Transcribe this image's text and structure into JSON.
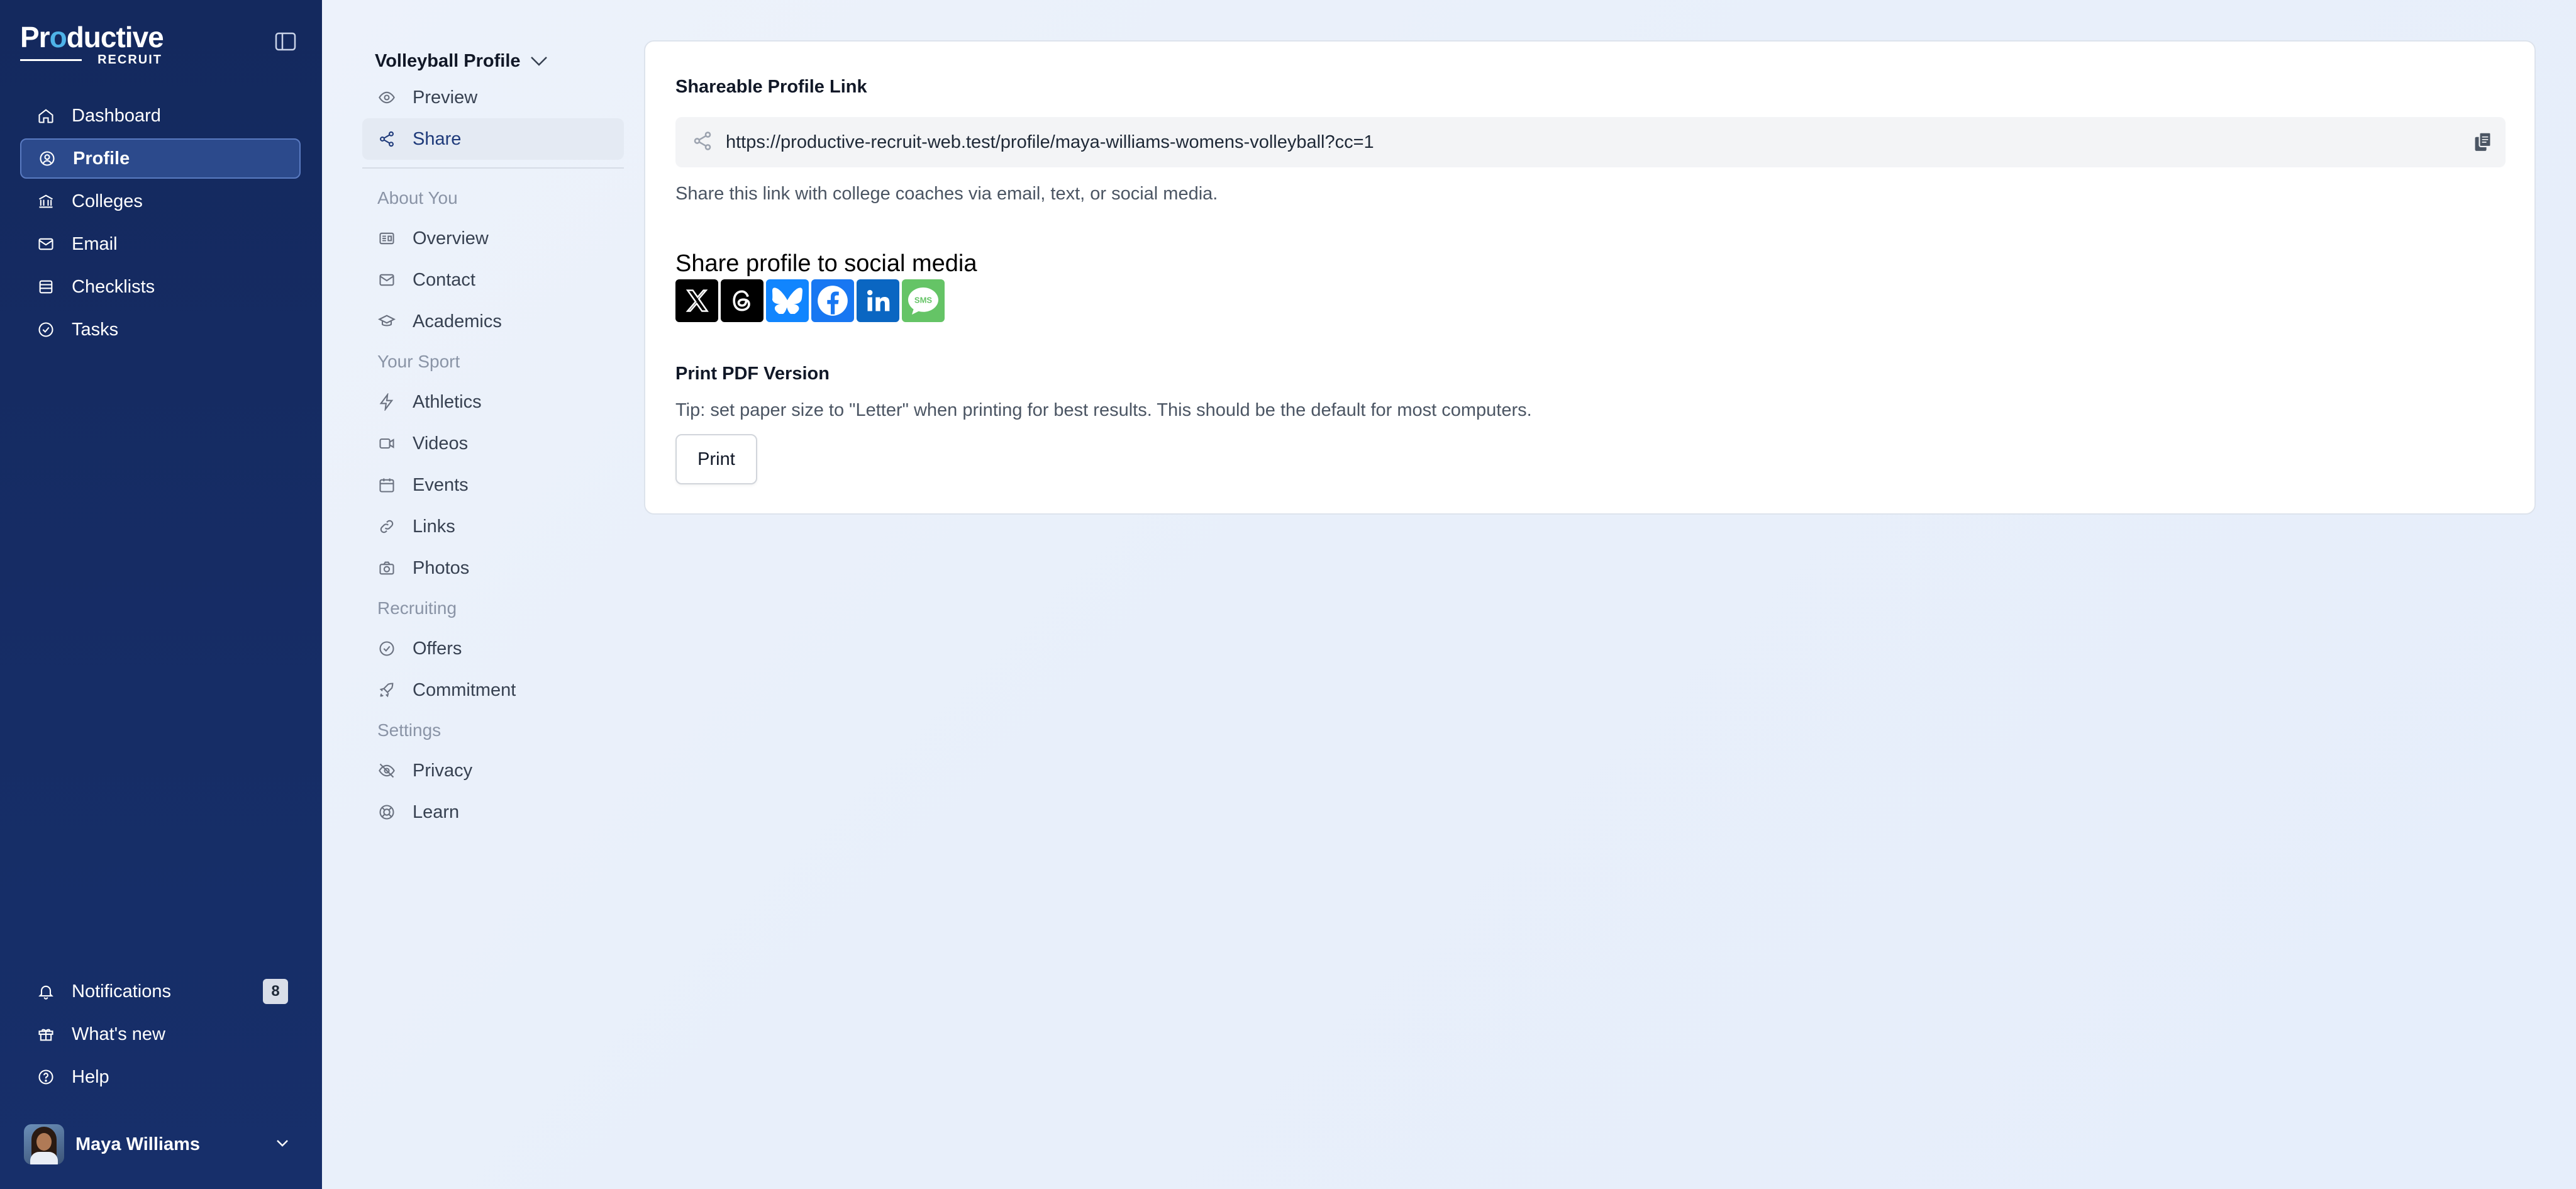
{
  "brand": {
    "name_part1": "Pr",
    "name_o": "o",
    "name_part2": "ductive",
    "sub": "RECRUIT"
  },
  "sidebar": {
    "items": [
      {
        "label": "Dashboard",
        "icon": "home-icon"
      },
      {
        "label": "Profile",
        "icon": "user-circle-icon",
        "active": true
      },
      {
        "label": "Colleges",
        "icon": "college-icon"
      },
      {
        "label": "Email",
        "icon": "mail-icon"
      },
      {
        "label": "Checklists",
        "icon": "list-icon"
      },
      {
        "label": "Tasks",
        "icon": "check-circle-icon"
      }
    ],
    "bottom": [
      {
        "label": "Notifications",
        "icon": "bell-icon",
        "badge": "8"
      },
      {
        "label": "What's new",
        "icon": "gift-icon"
      },
      {
        "label": "Help",
        "icon": "help-circle-icon"
      }
    ],
    "user": {
      "name": "Maya Williams"
    }
  },
  "subnav": {
    "profile_selector": "Volleyball Profile",
    "top_items": [
      {
        "label": "Preview",
        "icon": "eye-icon"
      },
      {
        "label": "Share",
        "icon": "share-icon",
        "active": true
      }
    ],
    "sections": [
      {
        "title": "About You",
        "items": [
          {
            "label": "Overview",
            "icon": "id-card-icon"
          },
          {
            "label": "Contact",
            "icon": "mail-icon"
          },
          {
            "label": "Academics",
            "icon": "graduation-cap-icon"
          }
        ]
      },
      {
        "title": "Your Sport",
        "items": [
          {
            "label": "Athletics",
            "icon": "bolt-icon"
          },
          {
            "label": "Videos",
            "icon": "video-icon"
          },
          {
            "label": "Events",
            "icon": "calendar-icon"
          },
          {
            "label": "Links",
            "icon": "link-icon"
          },
          {
            "label": "Photos",
            "icon": "camera-icon"
          }
        ]
      },
      {
        "title": "Recruiting",
        "items": [
          {
            "label": "Offers",
            "icon": "check-circle-icon"
          },
          {
            "label": "Commitment",
            "icon": "rocket-icon"
          }
        ]
      },
      {
        "title": "Settings",
        "items": [
          {
            "label": "Privacy",
            "icon": "eye-off-icon"
          },
          {
            "label": "Learn",
            "icon": "lifebuoy-icon"
          }
        ]
      }
    ]
  },
  "main": {
    "link_label": "Shareable Profile Link",
    "link_url": "https://productive-recruit-web.test/profile/maya-williams-womens-volleyball?cc=1",
    "link_help": "Share this link with college coaches via email, text, or social media.",
    "social_title": "Share profile to social media",
    "social": [
      {
        "name": "x",
        "icon": "x-icon",
        "color": "#000000"
      },
      {
        "name": "threads",
        "icon": "threads-icon",
        "color": "#000000"
      },
      {
        "name": "bluesky",
        "icon": "bluesky-icon",
        "color": "#1185fe"
      },
      {
        "name": "facebook",
        "icon": "facebook-icon",
        "color": "#1877f2"
      },
      {
        "name": "linkedin",
        "icon": "linkedin-icon",
        "color": "#0a66c2"
      },
      {
        "name": "sms",
        "icon": "sms-icon",
        "color": "#65c466"
      }
    ],
    "sms_label": "SMS",
    "print_label": "Print PDF Version",
    "print_tip": "Tip: set paper size to \"Letter\" when printing for best results. This should be the default for most computers.",
    "print_button": "Print"
  }
}
